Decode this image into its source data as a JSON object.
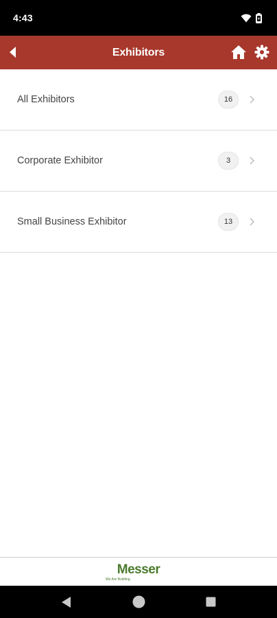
{
  "status_bar": {
    "time": "4:43"
  },
  "app_bar": {
    "title": "Exhibitors",
    "back_icon": "back-arrow-icon",
    "home_icon": "home-icon",
    "settings_icon": "gear-icon",
    "background_color": "#a8382c"
  },
  "categories": [
    {
      "label": "All Exhibitors",
      "count": "16"
    },
    {
      "label": "Corporate Exhibitor",
      "count": "3"
    },
    {
      "label": "Small Business Exhibitor",
      "count": "13"
    }
  ],
  "footer": {
    "sponsor_logo_word": "Messer",
    "sponsor_logo_tagline": "We Are Building.",
    "brand_color": "#4a7a2c"
  }
}
